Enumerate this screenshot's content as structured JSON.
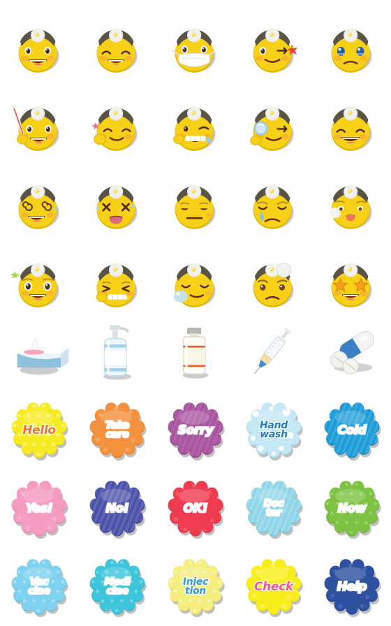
{
  "sheet": {
    "title": "Doctor Emoji Sticker Sheet",
    "columns": 5,
    "rows": 8,
    "background": "#ffffff",
    "face_color": "#f7d117",
    "face_shadow": "#e0b400",
    "headband_color": "#5c5347",
    "mirror_color": "#f2f2f0"
  },
  "stickers": [
    {
      "id": "r1c1",
      "row": 1,
      "col": 1,
      "kind": "face",
      "name": "doctor-smiling-open-mouth",
      "label": "Doctor smiling with open mouth"
    },
    {
      "id": "r1c2",
      "row": 1,
      "col": 2,
      "kind": "face",
      "name": "doctor-happy-closed-eyes",
      "label": "Doctor happy with closed eyes"
    },
    {
      "id": "r1c3",
      "row": 1,
      "col": 3,
      "kind": "face",
      "name": "doctor-wearing-face-mask",
      "label": "Doctor wearing face mask"
    },
    {
      "id": "r1c4",
      "row": 1,
      "col": 4,
      "kind": "face",
      "name": "doctor-winking-with-sparkle",
      "label": "Doctor winking with sparkle"
    },
    {
      "id": "r1c5",
      "row": 1,
      "col": 5,
      "kind": "face",
      "name": "doctor-sad-teary-eyes",
      "label": "Doctor sad with teary eyes"
    },
    {
      "id": "r2c1",
      "row": 2,
      "col": 1,
      "kind": "face",
      "name": "doctor-holding-thermometer",
      "label": "Doctor holding thermometer"
    },
    {
      "id": "r2c2",
      "row": 2,
      "col": 2,
      "kind": "face",
      "name": "doctor-saluting-shy-smile",
      "label": "Doctor with shy smile and hand"
    },
    {
      "id": "r2c3",
      "row": 2,
      "col": 3,
      "kind": "face",
      "name": "doctor-winking-toothy-grin",
      "label": "Doctor winking with toothy grin"
    },
    {
      "id": "r2c4",
      "row": 2,
      "col": 4,
      "kind": "face",
      "name": "doctor-with-magnifying-glass",
      "label": "Doctor with magnifying glass"
    },
    {
      "id": "r2c5",
      "row": 2,
      "col": 5,
      "kind": "face",
      "name": "doctor-laughing-closed-eyes",
      "label": "Doctor laughing with closed eyes"
    },
    {
      "id": "r3c1",
      "row": 3,
      "col": 1,
      "kind": "face",
      "name": "doctor-dizzy-spiral-eyes",
      "label": "Doctor dizzy with spiral eyes"
    },
    {
      "id": "r3c2",
      "row": 3,
      "col": 2,
      "kind": "face",
      "name": "doctor-knocked-out-x-eyes",
      "label": "Doctor knocked out with X eyes"
    },
    {
      "id": "r3c3",
      "row": 3,
      "col": 3,
      "kind": "face",
      "name": "doctor-unamused-flat-mouth",
      "label": "Doctor unamused flat mouth"
    },
    {
      "id": "r3c4",
      "row": 3,
      "col": 4,
      "kind": "face",
      "name": "doctor-crying-single-tear",
      "label": "Doctor crying single tear"
    },
    {
      "id": "r3c5",
      "row": 3,
      "col": 5,
      "kind": "face",
      "name": "doctor-sneezing-tissue",
      "label": "Doctor sneezing into tissue"
    },
    {
      "id": "r4c1",
      "row": 4,
      "col": 1,
      "kind": "face",
      "name": "doctor-excited-wide-eyes",
      "label": "Doctor excited wide eyes"
    },
    {
      "id": "r4c2",
      "row": 4,
      "col": 2,
      "kind": "face",
      "name": "doctor-pleading-squint-grin",
      "label": "Doctor squinting big grin"
    },
    {
      "id": "r4c3",
      "row": 4,
      "col": 3,
      "kind": "face",
      "name": "doctor-sleeping-snot-bubble",
      "label": "Doctor sleeping with snot bubble"
    },
    {
      "id": "r4c4",
      "row": 4,
      "col": 4,
      "kind": "face",
      "name": "doctor-frowning-ice-pack",
      "label": "Doctor frowning with ice pack"
    },
    {
      "id": "r4c5",
      "row": 4,
      "col": 5,
      "kind": "face",
      "name": "doctor-star-struck",
      "label": "Doctor star-struck"
    },
    {
      "id": "r5c1",
      "row": 5,
      "col": 1,
      "kind": "object",
      "name": "tissue-box",
      "label": "Tissue box"
    },
    {
      "id": "r5c2",
      "row": 5,
      "col": 2,
      "kind": "object",
      "name": "hand-sanitizer-pump",
      "label": "Hand sanitizer pump bottle"
    },
    {
      "id": "r5c3",
      "row": 5,
      "col": 3,
      "kind": "object",
      "name": "medicine-vial",
      "label": "Medicine vial"
    },
    {
      "id": "r5c4",
      "row": 5,
      "col": 4,
      "kind": "object",
      "name": "syringe",
      "label": "Syringe"
    },
    {
      "id": "r5c5",
      "row": 5,
      "col": 5,
      "kind": "object",
      "name": "pills-capsule",
      "label": "Capsule and pills"
    },
    {
      "id": "r6c1",
      "row": 6,
      "col": 1,
      "kind": "badge",
      "name": "badge-hello",
      "lines": [
        "Hello"
      ],
      "bg": "#f7ec23",
      "bg_dark": "#e7d814",
      "text": "#e8762b",
      "pattern": "dots",
      "pattern_color": "#fdf799",
      "stroke": "#ffffff"
    },
    {
      "id": "r6c2",
      "row": 6,
      "col": 2,
      "kind": "badge",
      "name": "badge-take-care",
      "lines": [
        "Take",
        "care"
      ],
      "bg": "#f3913f",
      "bg_dark": "#e27f2c",
      "text": "#ffffff",
      "pattern": "sparkle",
      "pattern_color": "#f8ae6b",
      "stroke": "#ffffff"
    },
    {
      "id": "r6c3",
      "row": 6,
      "col": 3,
      "kind": "badge",
      "name": "badge-sorry",
      "lines": [
        "Sorry"
      ],
      "bg": "#a6569d",
      "bg_dark": "#8e4187",
      "text": "#ffffff",
      "pattern": "stripes",
      "pattern_color": "#b868b0",
      "stroke": "#ffffff"
    },
    {
      "id": "r6c4",
      "row": 6,
      "col": 4,
      "kind": "badge",
      "name": "badge-hand-wash",
      "lines": [
        "Hand",
        "wash"
      ],
      "bg": "#c5e8f7",
      "bg_dark": "#a9d9ee",
      "text": "#1f7cc4",
      "pattern": "bubbles",
      "pattern_color": "#ffffff",
      "stroke": "#ffffff"
    },
    {
      "id": "r6c5",
      "row": 6,
      "col": 5,
      "kind": "badge",
      "name": "badge-cold",
      "lines": [
        "Cold"
      ],
      "bg": "#1d9bd7",
      "bg_dark": "#1383bb",
      "text": "#ffffff",
      "pattern": "stripes",
      "pattern_color": "#43b0e2",
      "stroke": "#ffffff"
    },
    {
      "id": "r7c1",
      "row": 7,
      "col": 1,
      "kind": "badge",
      "name": "badge-yes",
      "lines": [
        "Yes!"
      ],
      "bg": "#f59cc0",
      "bg_dark": "#ec82ad",
      "text": "#ffffff",
      "pattern": "sparkle",
      "pattern_color": "#f2b6d1",
      "stroke": "#ffffff"
    },
    {
      "id": "r7c2",
      "row": 7,
      "col": 2,
      "kind": "badge",
      "name": "badge-no",
      "lines": [
        "No!"
      ],
      "bg": "#4a50a5",
      "bg_dark": "#3c4291",
      "text": "#ffffff",
      "pattern": "stripes",
      "pattern_color": "#6a70bd",
      "stroke": "#ffffff"
    },
    {
      "id": "r7c3",
      "row": 7,
      "col": 3,
      "kind": "badge",
      "name": "badge-ok",
      "lines": [
        "OK!"
      ],
      "bg": "#ef3c51",
      "bg_dark": "#dc2940",
      "text": "#ffffff",
      "pattern": "stars",
      "pattern_color": "#f4606f",
      "stroke": "#ffffff"
    },
    {
      "id": "r7c4",
      "row": 7,
      "col": 4,
      "kind": "badge",
      "name": "badge-doctor",
      "lines": [
        "Doc",
        "tor"
      ],
      "bg": "#8ed4e8",
      "bg_dark": "#6fc3dc",
      "text": "#ffffff",
      "pattern": "stripes",
      "pattern_color": "#a9e0ef",
      "stroke": "#ffffff"
    },
    {
      "id": "r7c5",
      "row": 7,
      "col": 5,
      "kind": "badge",
      "name": "badge-now",
      "lines": [
        "Now"
      ],
      "bg": "#7dc242",
      "bg_dark": "#6aae33",
      "text": "#ffffff",
      "pattern": "dots",
      "pattern_color": "#a3d472",
      "stroke": "#ffffff"
    },
    {
      "id": "r8c1",
      "row": 8,
      "col": 1,
      "kind": "badge",
      "name": "badge-vaccine",
      "lines": [
        "Vac",
        "cine"
      ],
      "bg": "#7fd2f0",
      "bg_dark": "#5fc2e6",
      "text": "#ffffff",
      "pattern": "dots",
      "pattern_color": "#aee3f7",
      "stroke": "#ffffff"
    },
    {
      "id": "r8c2",
      "row": 8,
      "col": 2,
      "kind": "badge",
      "name": "badge-medicine",
      "lines": [
        "Medi",
        "cine"
      ],
      "bg": "#3dc5dc",
      "bg_dark": "#28b2cb",
      "text": "#ffffff",
      "pattern": "dots",
      "pattern_color": "#7fd9e9",
      "stroke": "#ffffff"
    },
    {
      "id": "r8c3",
      "row": 8,
      "col": 3,
      "kind": "badge",
      "name": "badge-injection",
      "lines": [
        "Injec",
        "tion"
      ],
      "bg": "#f5ee80",
      "bg_dark": "#e9e15f",
      "text": "#2a9fd8",
      "pattern": "dots",
      "pattern_color": "#faf6b8",
      "stroke": "#ffffff"
    },
    {
      "id": "r8c4",
      "row": 8,
      "col": 4,
      "kind": "badge",
      "name": "badge-check",
      "lines": [
        "Check"
      ],
      "bg": "#f8ee1c",
      "bg_dark": "#ecdf0f",
      "text": "#ef5a8a",
      "pattern": "sparkle",
      "pattern_color": "#fbf46c",
      "stroke": "#ffffff"
    },
    {
      "id": "r8c5",
      "row": 8,
      "col": 5,
      "kind": "badge",
      "name": "badge-help",
      "lines": [
        "Help"
      ],
      "bg": "#2e51a0",
      "bg_dark": "#24428b",
      "text": "#ffffff",
      "pattern": "sparkle",
      "pattern_color": "#4c6bb5",
      "stroke": "#ffffff"
    }
  ]
}
